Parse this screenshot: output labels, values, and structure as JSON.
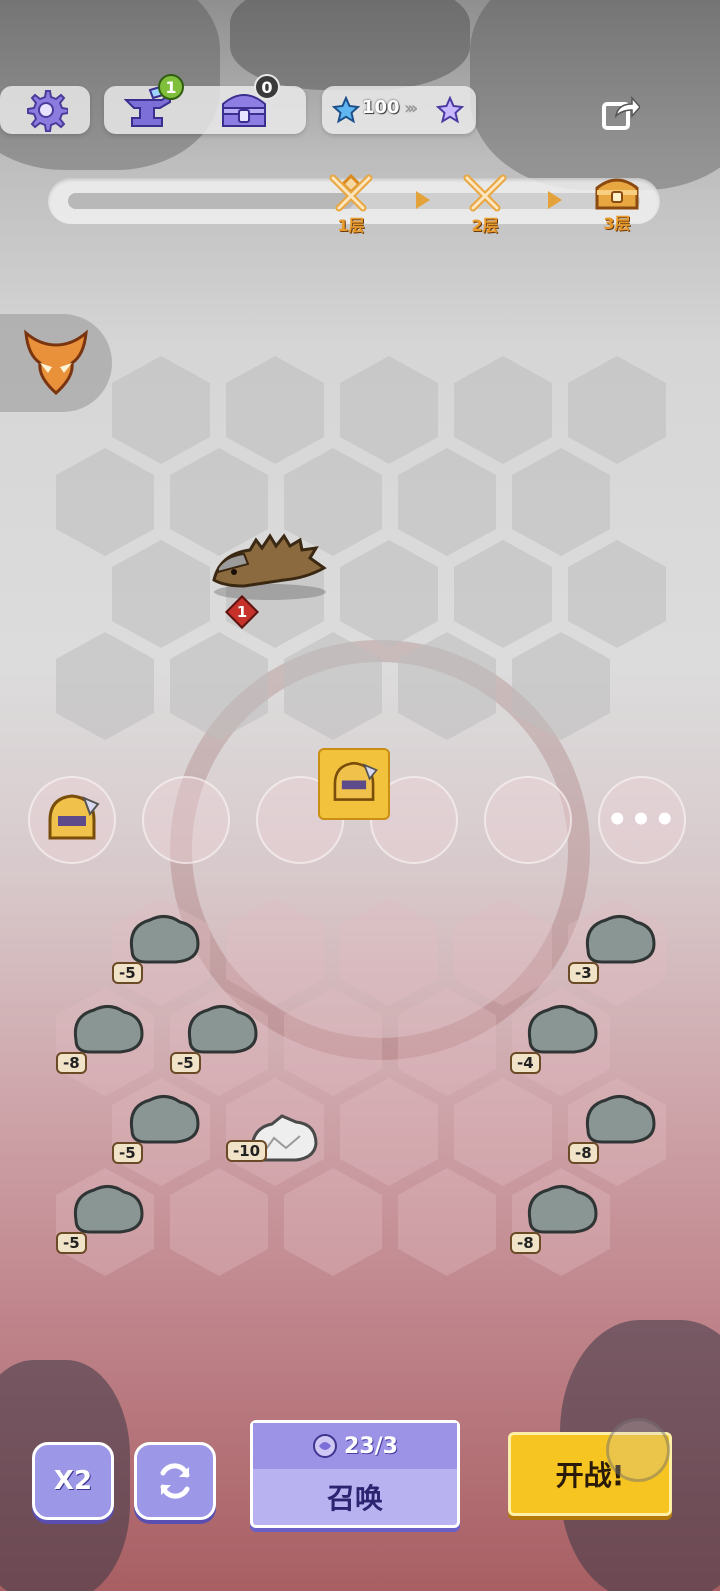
{
  "top_bar": {
    "forge_count": "1",
    "chest_count": "0",
    "star_count": "100"
  },
  "progress": {
    "stages": [
      {
        "label": "1层"
      },
      {
        "label": "2层"
      },
      {
        "label": "3层"
      }
    ],
    "current_stage": 1
  },
  "enemy": {
    "level": "1"
  },
  "player_units": [
    {
      "value": "-5"
    },
    {
      "value": "-3"
    },
    {
      "value": "-8"
    },
    {
      "value": "-5"
    },
    {
      "value": "-4"
    },
    {
      "value": "-5"
    },
    {
      "value": "-10"
    },
    {
      "value": "-8"
    },
    {
      "value": "-5"
    },
    {
      "value": "-8"
    }
  ],
  "bottom": {
    "speed_label": "X2",
    "summon_cost": "23/3",
    "summon_label": "召唤",
    "fight_label": "开战!"
  },
  "colors": {
    "accent_purple": "#9d97e8",
    "fight_yellow": "#f7c521",
    "badge_green": "#7fbf3b"
  }
}
